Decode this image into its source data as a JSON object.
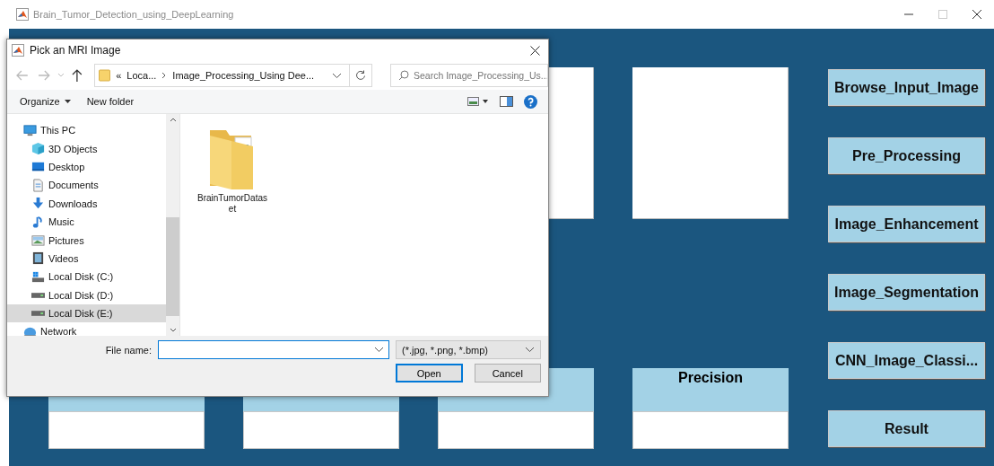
{
  "window": {
    "title": "Brain_Tumor_Detection_using_DeepLearning"
  },
  "plots": [
    {
      "kind": "empty"
    },
    {
      "kind": "empty"
    }
  ],
  "metrics": [
    {
      "kind": "covered"
    },
    {
      "kind": "covered"
    },
    {
      "kind": "covered"
    },
    {
      "kind": "labeled",
      "label": "Precision"
    }
  ],
  "buttons": [
    "Browse_Input_Image",
    "Pre_Processing",
    "Image_Enhancement",
    "Image_Segmentation",
    "CNN_Image_Classi...",
    "Result"
  ],
  "dialog": {
    "title": "Pick an MRI Image",
    "breadcrumb": {
      "overflow": "«",
      "items": [
        "Loca...",
        "Image_Processing_Using Dee..."
      ]
    },
    "search": {
      "placeholder": "Search Image_Processing_Us..."
    },
    "toolbar": [
      "Organize",
      "New folder"
    ],
    "tree": [
      {
        "label": "This PC",
        "kind": "pc",
        "selected": false,
        "children": [
          {
            "label": "3D Objects",
            "kind": "objects3d",
            "selected": false
          },
          {
            "label": "Desktop",
            "kind": "desktop",
            "selected": false
          },
          {
            "label": "Documents",
            "kind": "documents",
            "selected": false
          },
          {
            "label": "Downloads",
            "kind": "downloads",
            "selected": false
          },
          {
            "label": "Music",
            "kind": "music",
            "selected": false
          },
          {
            "label": "Pictures",
            "kind": "pictures",
            "selected": false
          },
          {
            "label": "Videos",
            "kind": "videos",
            "selected": false
          },
          {
            "label": "Local Disk (C:)",
            "kind": "system-drive",
            "selected": false
          },
          {
            "label": "Local Disk (D:)",
            "kind": "drive",
            "selected": false
          },
          {
            "label": "Local Disk (E:)",
            "kind": "drive",
            "selected": true
          }
        ]
      },
      {
        "label": "Network",
        "kind": "network",
        "selected": false
      }
    ],
    "files": [
      {
        "name": "BrainTumorDataset",
        "kind": "folder"
      }
    ],
    "file_name_label": "File name:",
    "file_type": "(*.jpg, *.png, *.bmp)",
    "actions": [
      {
        "label": "Open",
        "default": true
      },
      {
        "label": "Cancel",
        "default": false
      }
    ]
  }
}
